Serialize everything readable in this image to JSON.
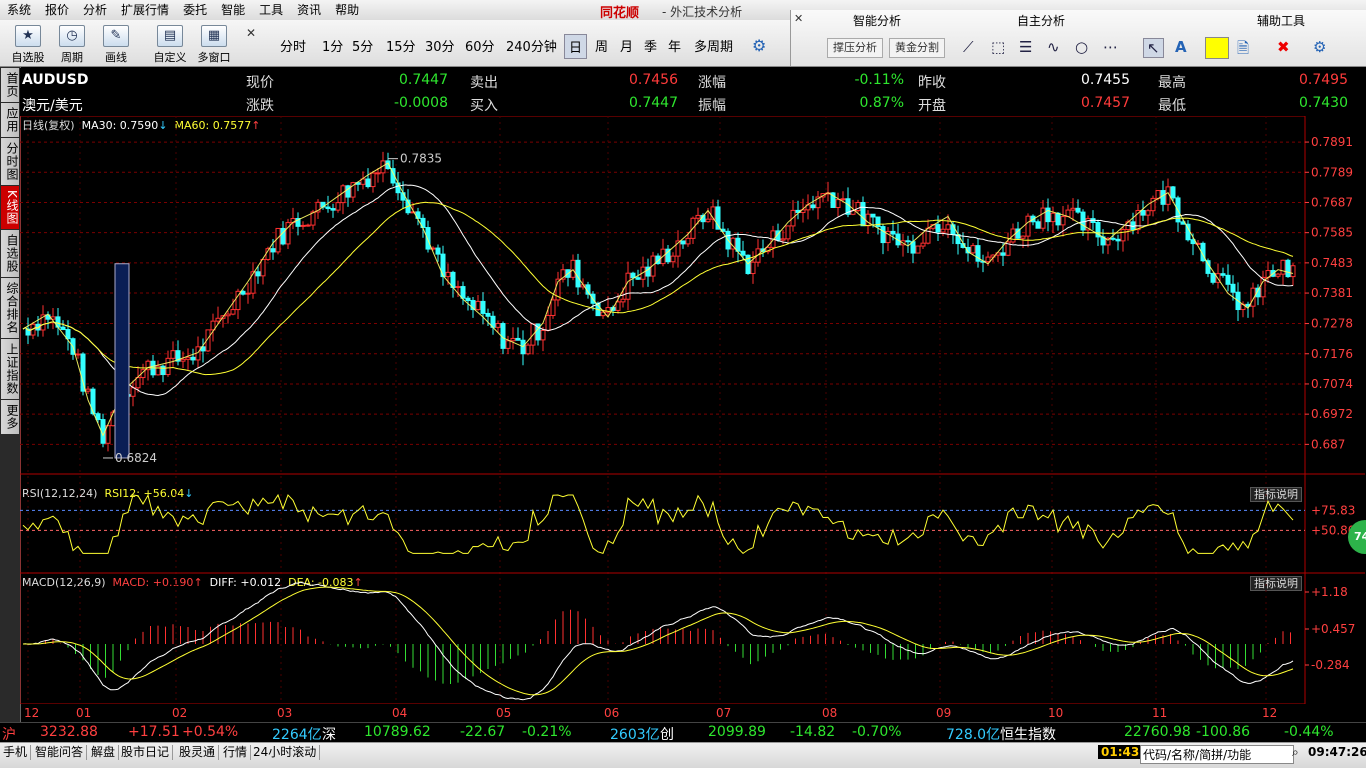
{
  "menu": [
    "系统",
    "报价",
    "分析",
    "扩展行情",
    "委托",
    "智能",
    "工具",
    "资讯",
    "帮助"
  ],
  "brand": "同花顺",
  "app_title": "- 外汇技术分析",
  "toolbar": {
    "buttons": [
      {
        "label": "自选股",
        "icon": "star-icon"
      },
      {
        "label": "周期",
        "icon": "clock-icon"
      },
      {
        "label": "画线",
        "icon": "pen-icon"
      },
      {
        "label": "自定义",
        "icon": "custom-icon"
      },
      {
        "label": "多窗口",
        "icon": "windows-icon"
      }
    ],
    "periods": [
      "分时",
      "1分",
      "5分",
      "15分",
      "30分",
      "60分",
      "240分钟",
      "日",
      "周",
      "月",
      "季",
      "年",
      "多周期"
    ],
    "active_period": "日"
  },
  "smart_panel": {
    "titles": [
      "智能分析",
      "自主分析",
      "辅助工具"
    ],
    "buttons": [
      "撑压分析",
      "黄金分割"
    ]
  },
  "side_tabs": [
    "首页",
    "应用",
    "分时图",
    "K线图",
    "自选股",
    "综合排名",
    "上证指数",
    "更多"
  ],
  "active_side_tab": "K线图",
  "quote": {
    "symbol": "AUDUSD",
    "name": "澳元/美元",
    "rows": [
      [
        {
          "label": "现价",
          "value": "0.7447",
          "color": "green"
        },
        {
          "label": "卖出",
          "value": "0.7456",
          "color": "red"
        },
        {
          "label": "涨幅",
          "value": "-0.11%",
          "color": "green"
        },
        {
          "label": "昨收",
          "value": "0.7455",
          "color": "white"
        },
        {
          "label": "最高",
          "value": "0.7495",
          "color": "red"
        }
      ],
      [
        {
          "label": "涨跌",
          "value": "-0.0008",
          "color": "green"
        },
        {
          "label": "买入",
          "value": "0.7447",
          "color": "green"
        },
        {
          "label": "振幅",
          "value": "0.87%",
          "color": "green"
        },
        {
          "label": "开盘",
          "value": "0.7457",
          "color": "red"
        },
        {
          "label": "最低",
          "value": "0.7430",
          "color": "green"
        }
      ]
    ]
  },
  "main_indicator": {
    "name": "日线(复权)",
    "ma30": "MA30: 0.7590",
    "ma60": "MA60: 0.7577",
    "high_label": "0.7835",
    "low_label": "0.6824"
  },
  "rsi_indicator": {
    "name": "RSI(12,12,24)",
    "value": "RSI12: +56.04",
    "help": "指标说明",
    "levels": [
      "+75.83",
      "+50.80"
    ]
  },
  "macd_indicator": {
    "name": "MACD(12,26,9)",
    "macd": "MACD: +0.190",
    "diff": "DIFF: +0.012",
    "dea": "DEA: -0.083",
    "help": "指标说明",
    "levels": [
      "+1.18",
      "+0.457",
      "-0.284"
    ]
  },
  "badge": "74",
  "dates": [
    "12",
    "01",
    "02",
    "03",
    "04",
    "05",
    "06",
    "07",
    "08",
    "09",
    "10",
    "11",
    "12"
  ],
  "index_bar": [
    {
      "text": "沪",
      "color": "#ff4040"
    },
    {
      "text": "3232.88",
      "color": "#ff4040"
    },
    {
      "text": "+17.51",
      "color": "#ff4040"
    },
    {
      "text": "+0.54%",
      "color": "#ff4040"
    },
    {
      "text": "2264亿",
      "color": "#33ccff"
    },
    {
      "text": "深",
      "color": "#fff"
    },
    {
      "text": "10789.62",
      "color": "#2ee62e"
    },
    {
      "text": "-22.67",
      "color": "#2ee62e"
    },
    {
      "text": "-0.21%",
      "color": "#2ee62e"
    },
    {
      "text": "2603亿",
      "color": "#33ccff"
    },
    {
      "text": "创",
      "color": "#fff"
    },
    {
      "text": "2099.89",
      "color": "#2ee62e"
    },
    {
      "text": "-14.82",
      "color": "#2ee62e"
    },
    {
      "text": "-0.70%",
      "color": "#2ee62e"
    },
    {
      "text": "728.0亿",
      "color": "#33ccff"
    },
    {
      "text": "恒生指数",
      "color": "#fff"
    },
    {
      "text": "22760.98",
      "color": "#2ee62e"
    },
    {
      "text": "-100.86",
      "color": "#2ee62e"
    },
    {
      "text": "-0.44%",
      "color": "#2ee62e"
    }
  ],
  "status_bar": [
    "手机",
    "智能问答",
    "解盘",
    "股市日记",
    "股灵通",
    "行情",
    "24小时滚动"
  ],
  "status_time_left": "01:43",
  "status_search": "代码/名称/简拼/功能",
  "status_time_right": "09:47:26",
  "chart_data": {
    "type": "candlestick",
    "symbol": "AUDUSD",
    "period": "daily",
    "y_ticks": [
      0.7891,
      0.7789,
      0.7687,
      0.7585,
      0.7483,
      0.7381,
      0.7278,
      0.7176,
      0.7074,
      0.6972,
      0.687
    ],
    "ylim": [
      0.678,
      0.7925
    ],
    "x_month_labels": [
      "12",
      "01",
      "02",
      "03",
      "04",
      "05",
      "06",
      "07",
      "08",
      "09",
      "10",
      "11",
      "12"
    ],
    "highest": 0.7835,
    "lowest": 0.6824,
    "key_closes": [
      [
        0,
        0.726
      ],
      [
        10,
        0.731
      ],
      [
        20,
        0.72
      ],
      [
        26,
        0.702
      ],
      [
        32,
        0.69
      ],
      [
        40,
        0.705
      ],
      [
        50,
        0.713
      ],
      [
        60,
        0.715
      ],
      [
        70,
        0.718
      ],
      [
        80,
        0.73
      ],
      [
        90,
        0.742
      ],
      [
        100,
        0.755
      ],
      [
        108,
        0.762
      ],
      [
        118,
        0.766
      ],
      [
        128,
        0.772
      ],
      [
        138,
        0.778
      ],
      [
        146,
        0.782
      ],
      [
        152,
        0.772
      ],
      [
        160,
        0.76
      ],
      [
        168,
        0.744
      ],
      [
        176,
        0.736
      ],
      [
        184,
        0.73
      ],
      [
        192,
        0.723
      ],
      [
        200,
        0.72
      ],
      [
        208,
        0.728
      ],
      [
        214,
        0.742
      ],
      [
        220,
        0.746
      ],
      [
        228,
        0.736
      ],
      [
        234,
        0.73
      ],
      [
        242,
        0.742
      ],
      [
        250,
        0.746
      ],
      [
        258,
        0.752
      ],
      [
        266,
        0.758
      ],
      [
        274,
        0.766
      ],
      [
        282,
        0.756
      ],
      [
        290,
        0.748
      ],
      [
        298,
        0.754
      ],
      [
        306,
        0.762
      ],
      [
        314,
        0.768
      ],
      [
        322,
        0.772
      ],
      [
        330,
        0.768
      ],
      [
        338,
        0.762
      ],
      [
        346,
        0.758
      ],
      [
        354,
        0.754
      ],
      [
        362,
        0.76
      ],
      [
        370,
        0.764
      ],
      [
        378,
        0.752
      ],
      [
        386,
        0.748
      ],
      [
        394,
        0.756
      ],
      [
        402,
        0.762
      ],
      [
        410,
        0.766
      ],
      [
        418,
        0.764
      ],
      [
        426,
        0.76
      ],
      [
        434,
        0.756
      ],
      [
        442,
        0.762
      ],
      [
        450,
        0.768
      ],
      [
        458,
        0.772
      ],
      [
        466,
        0.76
      ],
      [
        474,
        0.748
      ],
      [
        482,
        0.738
      ],
      [
        490,
        0.733
      ],
      [
        496,
        0.742
      ],
      [
        502,
        0.746
      ],
      [
        508,
        0.7447
      ]
    ]
  }
}
